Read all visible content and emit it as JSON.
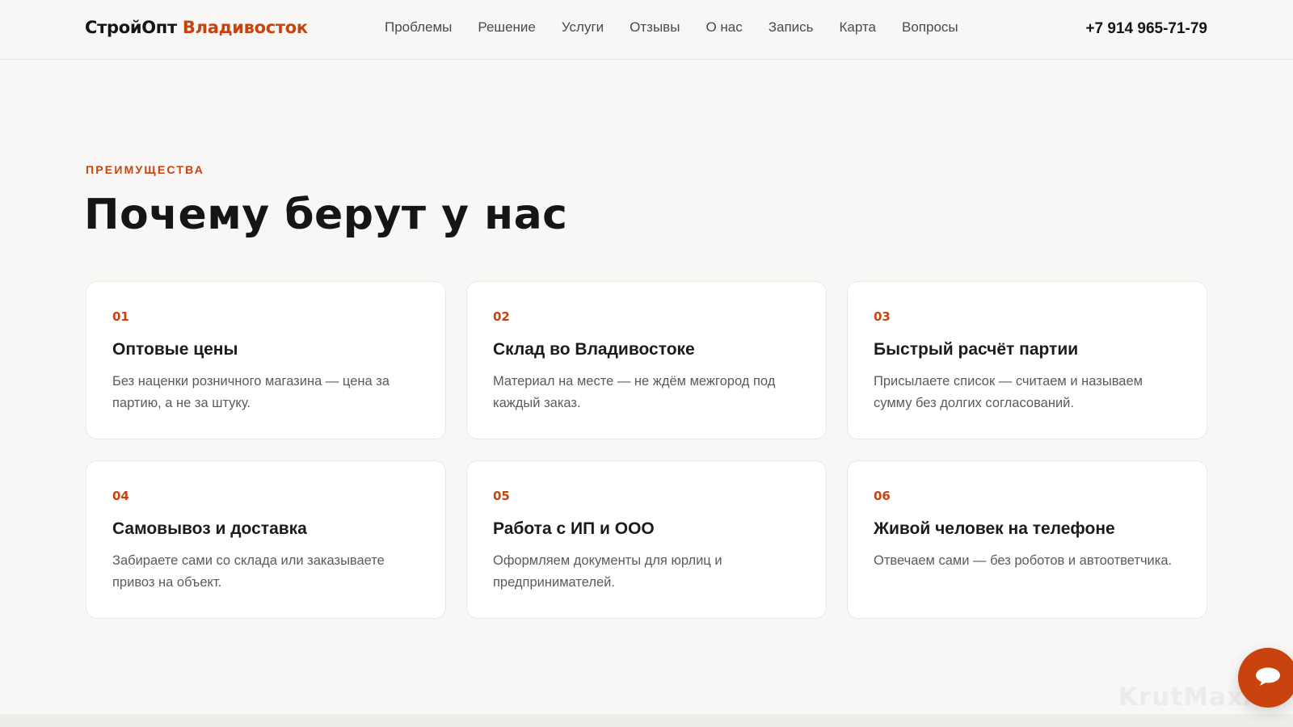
{
  "header": {
    "logo_main": "СтройОпт",
    "logo_accent": "Владивосток",
    "nav": [
      {
        "label": "Проблемы"
      },
      {
        "label": "Решение"
      },
      {
        "label": "Услуги"
      },
      {
        "label": "Отзывы"
      },
      {
        "label": "О нас"
      },
      {
        "label": "Запись"
      },
      {
        "label": "Карта"
      },
      {
        "label": "Вопросы"
      }
    ],
    "phone": "+7 914 965-71-79"
  },
  "section": {
    "eyebrow": "ПРЕИМУЩЕСТВА",
    "title": "Почему берут у нас",
    "cards": [
      {
        "num": "01",
        "title": "Оптовые цены",
        "text": "Без наценки розничного магазина — цена за партию, а не за штуку."
      },
      {
        "num": "02",
        "title": "Склад во Владивостоке",
        "text": "Материал на месте — не ждём межгород под каждый заказ."
      },
      {
        "num": "03",
        "title": "Быстрый расчёт партии",
        "text": "Присылаете список — считаем и называем сумму без долгих согласований."
      },
      {
        "num": "04",
        "title": "Самовывоз и доставка",
        "text": "Забираете сами со склада или заказываете привоз на объект."
      },
      {
        "num": "05",
        "title": "Работа с ИП и ООО",
        "text": "Оформляем документы для юрлиц и предпринимателей."
      },
      {
        "num": "06",
        "title": "Живой человек на телефоне",
        "text": "Отвечаем сами — без роботов и автоответчика."
      }
    ]
  },
  "chat_widget": {
    "icon": "chat-bubble-icon"
  },
  "watermark": "KrutMaxAI",
  "colors": {
    "accent": "#c8430e",
    "background": "#f8f7f5",
    "card": "#ffffff",
    "text": "#1b1b1b",
    "muted": "#5b5b5b"
  }
}
